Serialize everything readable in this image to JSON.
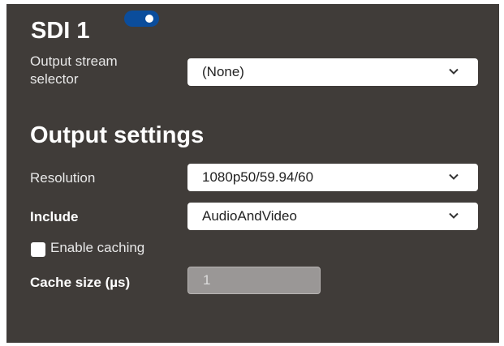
{
  "header": {
    "title": "SDI 1",
    "enabled": true
  },
  "output_stream": {
    "label_line1": "Output stream",
    "label_line2": "selector",
    "value": "(None)"
  },
  "output_settings": {
    "heading": "Output settings",
    "resolution": {
      "label": "Resolution",
      "value": "1080p50/59.94/60"
    },
    "include": {
      "label": "Include",
      "value": "AudioAndVideo"
    },
    "caching": {
      "label": "Enable caching",
      "checked": false
    },
    "cache_size": {
      "label": "Cache size (µs)",
      "value": "1"
    }
  },
  "colors": {
    "panel_bg": "#403c39",
    "toggle_on": "#0b4d9c",
    "input_bg": "#ffffff",
    "disabled_input_bg": "#9a9796"
  }
}
